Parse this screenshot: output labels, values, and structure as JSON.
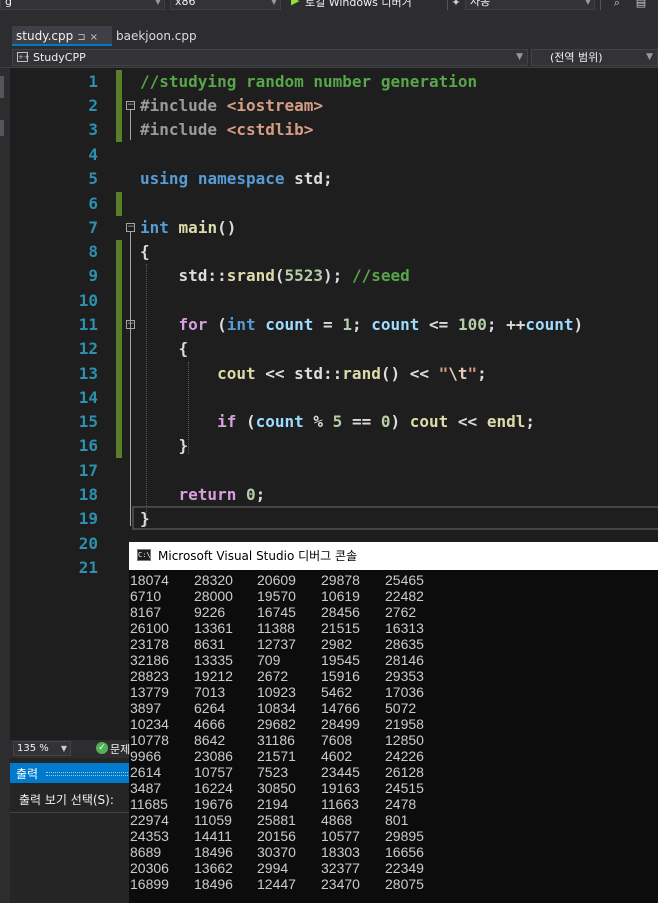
{
  "toolbar": {
    "config_value": "g",
    "platform_value": "x86",
    "run_label": "로컬 Windows 디버거",
    "mode_value": "자동"
  },
  "tabs": [
    {
      "label": "study.cpp",
      "pin": "⊐",
      "close": "×"
    },
    {
      "label": "baekjoon.cpp"
    }
  ],
  "navbar": {
    "project": "StudyCPP",
    "scope": "(전역 범위)"
  },
  "editor": {
    "line_numbers": [
      "1",
      "2",
      "3",
      "4",
      "5",
      "6",
      "7",
      "8",
      "9",
      "10",
      "11",
      "12",
      "13",
      "14",
      "15",
      "16",
      "17",
      "18",
      "19",
      "20",
      "21"
    ]
  },
  "console": {
    "title": "Microsoft Visual Studio 디버그 콘솔",
    "icon_label": "C:\\",
    "rows": [
      [
        "18074",
        "28320",
        "20609",
        "29878",
        "25465"
      ],
      [
        "6710",
        "28000",
        "19570",
        "10619",
        "22482"
      ],
      [
        "8167",
        "9226",
        "16745",
        "28456",
        "2762"
      ],
      [
        "26100",
        "13361",
        "11388",
        "21515",
        "16313"
      ],
      [
        "23178",
        "8631",
        "12737",
        "2982",
        "28635"
      ],
      [
        "32186",
        "13335",
        "709",
        "19545",
        "28146"
      ],
      [
        "28823",
        "19212",
        "2672",
        "15916",
        "29353"
      ],
      [
        "13779",
        "7013",
        "10923",
        "5462",
        "17036"
      ],
      [
        "3897",
        "6264",
        "10834",
        "14766",
        "5072"
      ],
      [
        "10234",
        "4666",
        "29682",
        "28499",
        "21958"
      ],
      [
        "10778",
        "8642",
        "31186",
        "7608",
        "12850"
      ],
      [
        "9966",
        "23086",
        "21571",
        "4602",
        "24226"
      ],
      [
        "2614",
        "10757",
        "7523",
        "23445",
        "26128"
      ],
      [
        "3487",
        "16224",
        "30850",
        "19163",
        "24515"
      ],
      [
        "11685",
        "19676",
        "2194",
        "11663",
        "2478"
      ],
      [
        "22974",
        "11059",
        "25881",
        "4868",
        "801"
      ],
      [
        "24353",
        "14411",
        "20156",
        "10577",
        "29895"
      ],
      [
        "8689",
        "18496",
        "30370",
        "18303",
        "16656"
      ],
      [
        "20306",
        "13662",
        "2994",
        "32377",
        "22349"
      ],
      [
        "16899",
        "18496",
        "12447",
        "23470",
        "28075"
      ]
    ]
  },
  "status": {
    "zoom": "135 %",
    "issues_label": "문제"
  },
  "output": {
    "title": "출력",
    "select_label": "출력 보기 선택(S):"
  },
  "colors": {
    "editor_bg": "#1e1e1e",
    "keyword": "#569cd6",
    "comment": "#57a64a",
    "string": "#d69d85",
    "number": "#b5cea8",
    "line_number": "#2b91af",
    "accent": "#007acc"
  }
}
